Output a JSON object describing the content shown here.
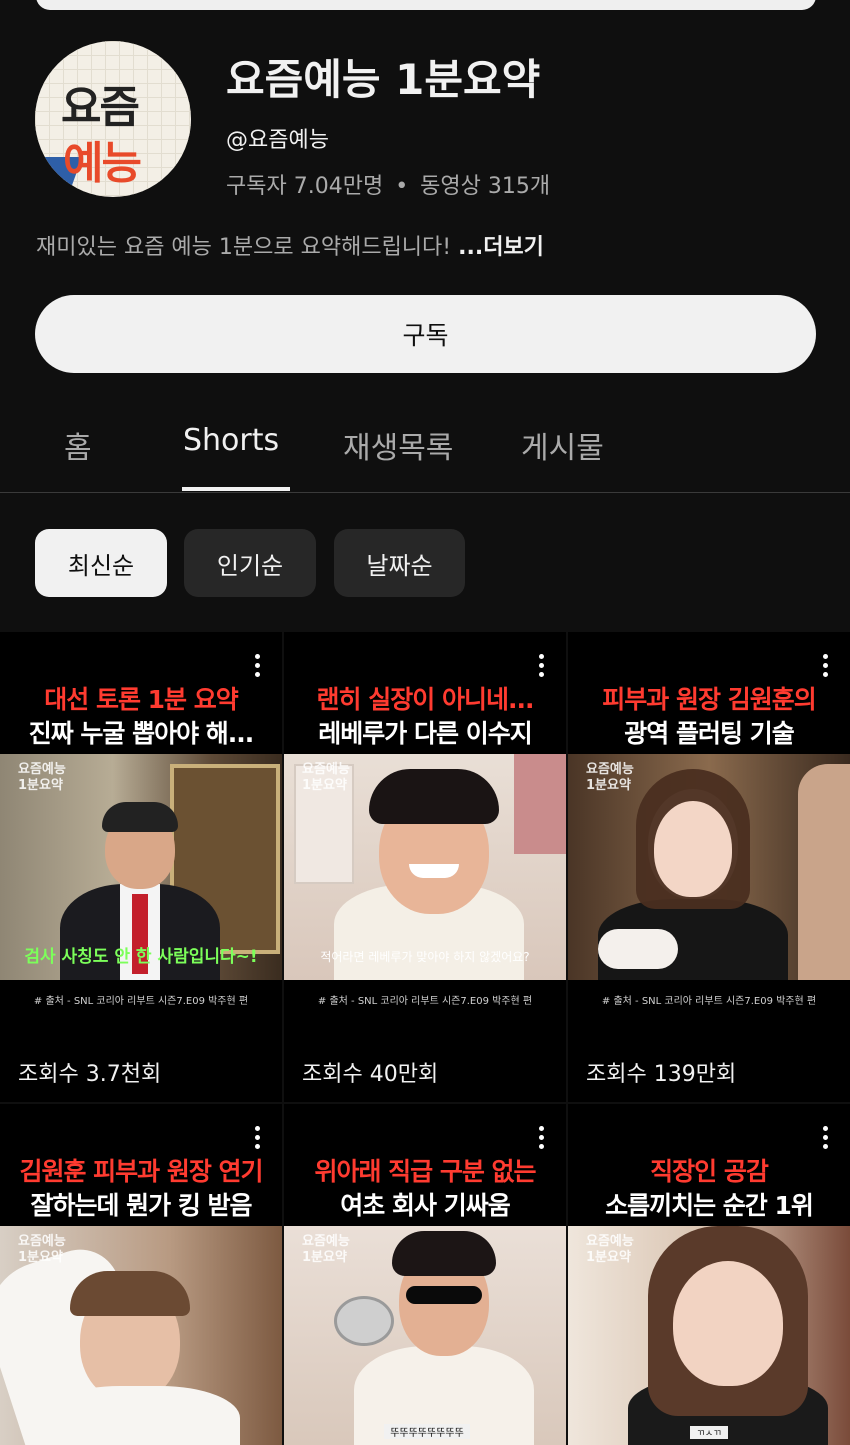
{
  "channel": {
    "avatar_line1": "요즘",
    "avatar_line2": "예능",
    "name": "요즘예능 1분요약",
    "handle": "@요즘예능",
    "subscribers": "구독자 7.04만명",
    "videos": "동영상 315개",
    "separator": "•",
    "description": "재미있는 요즘 예능 1분으로 요약해드립니다!",
    "more_label": "...더보기"
  },
  "subscribe_label": "구독",
  "tabs": [
    {
      "label": "홈"
    },
    {
      "label": "Shorts"
    },
    {
      "label": "재생목록"
    },
    {
      "label": "게시물"
    }
  ],
  "chips": [
    {
      "label": "최신순"
    },
    {
      "label": "인기순"
    },
    {
      "label": "날짜순"
    }
  ],
  "shorts": [
    {
      "title1": "대선 토론 1분 요약",
      "title2": "진짜 누굴 뽑아야 해...",
      "watermark1": "요즘예능",
      "watermark2": "1분요약",
      "caption": "검사 사칭도 안 한 사람입니다~!",
      "source": "# 출처 - SNL 코리아 리부트 시즌7.E09 박주현 편",
      "views": "조회수 3.7천회"
    },
    {
      "title1": "랜히 실장이 아니네...",
      "title2": "레베루가 다른 이수지",
      "watermark1": "요즘예능",
      "watermark2": "1분요약",
      "caption": "적어라면 레베루가 맞아야 하지 않겠어요?",
      "source": "# 출처 - SNL 코리아 리부트 시즌7.E09 박주현 편",
      "views": "조회수 40만회"
    },
    {
      "title1": "피부과 원장 김원훈의",
      "title2": "광역 플러팅 기술",
      "watermark1": "요즘예능",
      "watermark2": "1분요약",
      "caption": "",
      "source": "# 출처 - SNL 코리아 리부트 시즌7.E09 박주현 편",
      "views": "조회수 139만회"
    },
    {
      "title1": "김원훈 피부과 원장 연기",
      "title2": "잘하는데 뭔가 킹 받음",
      "watermark1": "요즘예능",
      "watermark2": "1분요약",
      "caption": "",
      "source": "",
      "views": ""
    },
    {
      "title1": "위아래 직급 구분 없는",
      "title2": "여초 회사 기싸움",
      "watermark1": "요즘예능",
      "watermark2": "1분요약",
      "caption": "뚜뚜뚜뚜뚜뚜뚜뚜",
      "source": "",
      "views": ""
    },
    {
      "title1": "직장인 공감",
      "title2": "소름끼치는 순간 1위",
      "watermark1": "요즘예능",
      "watermark2": "1분요약",
      "caption": "ㄲㅅㄲ",
      "source": "",
      "views": ""
    }
  ],
  "colors": {
    "background": "#0f0f0f",
    "title_red": "#ff3b30",
    "chip_active": "#f1f1f1",
    "chip": "#272727"
  }
}
